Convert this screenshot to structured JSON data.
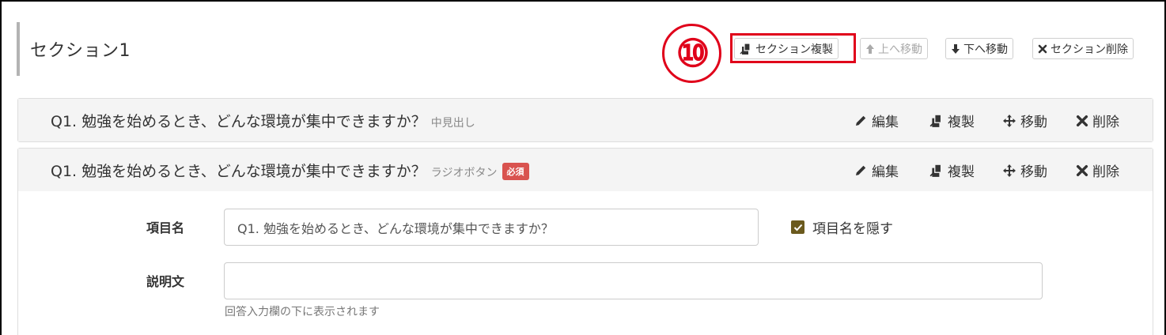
{
  "section": {
    "title": "セクション1",
    "callout_number": "⑩",
    "toolbar": {
      "duplicate_label": "セクション複製",
      "move_up_label": "上へ移動",
      "move_down_label": "下へ移動",
      "delete_label": "セクション削除"
    }
  },
  "questions": [
    {
      "title": "Q1. 勉強を始めるとき、どんな環境が集中できますか？",
      "type": "中見出し",
      "actions": {
        "edit": "編集",
        "duplicate": "複製",
        "move": "移動",
        "delete": "削除"
      }
    },
    {
      "title": "Q1. 勉強を始めるとき、どんな環境が集中できますか？",
      "type": "ラジオボタン",
      "required_badge": "必須",
      "actions": {
        "edit": "編集",
        "duplicate": "複製",
        "move": "移動",
        "delete": "削除"
      },
      "form": {
        "item_name_label": "項目名",
        "item_name_value": "Q1. 勉強を始めるとき、どんな環境が集中できますか？",
        "hide_item_name_label": "項目名を隠す",
        "hide_item_name_checked": true,
        "description_label": "説明文",
        "description_value": "",
        "description_help": "回答入力欄の下に表示されます"
      }
    }
  ],
  "colors": {
    "highlight": "#e0001a",
    "required": "#d9534f",
    "checkbox": "#6b5a1e"
  }
}
